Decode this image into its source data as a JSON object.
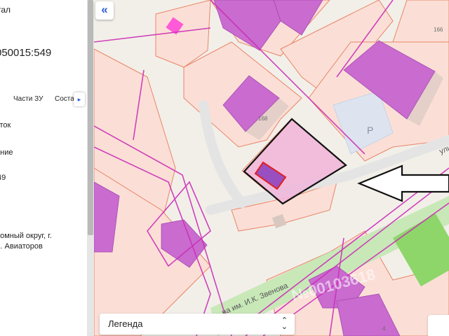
{
  "panel": {
    "object_kind": "тал",
    "cadastral_number": "050015:549",
    "tabs": [
      "Части ЗУ",
      "Соста"
    ],
    "tab_next_glyph": "▸",
    "type_value": "сток",
    "status_value": "ание",
    "number_value": "49",
    "address_line1": "номный округ, г.",
    "address_line2": "л. Авиаторов"
  },
  "map": {
    "collapse_glyph": "«",
    "building_labels": [
      "166",
      "168",
      "4"
    ],
    "parking_label": "P",
    "street_label_main": "на им. И.К. Звенова",
    "street_label_side": "ули",
    "watermark": "№00103618"
  },
  "legend": {
    "label": "Легенда",
    "chevron": "⌃⌄"
  },
  "colors": {
    "parcel_border": "#e98566",
    "parcel_fill": "#fbdfd7",
    "building_fill": "#c96bcf",
    "boundary_magenta": "#cc2fb6",
    "selected_outline": "#e02020",
    "accent_blue": "#2a5bd7",
    "park_green": "#8ed66a"
  }
}
